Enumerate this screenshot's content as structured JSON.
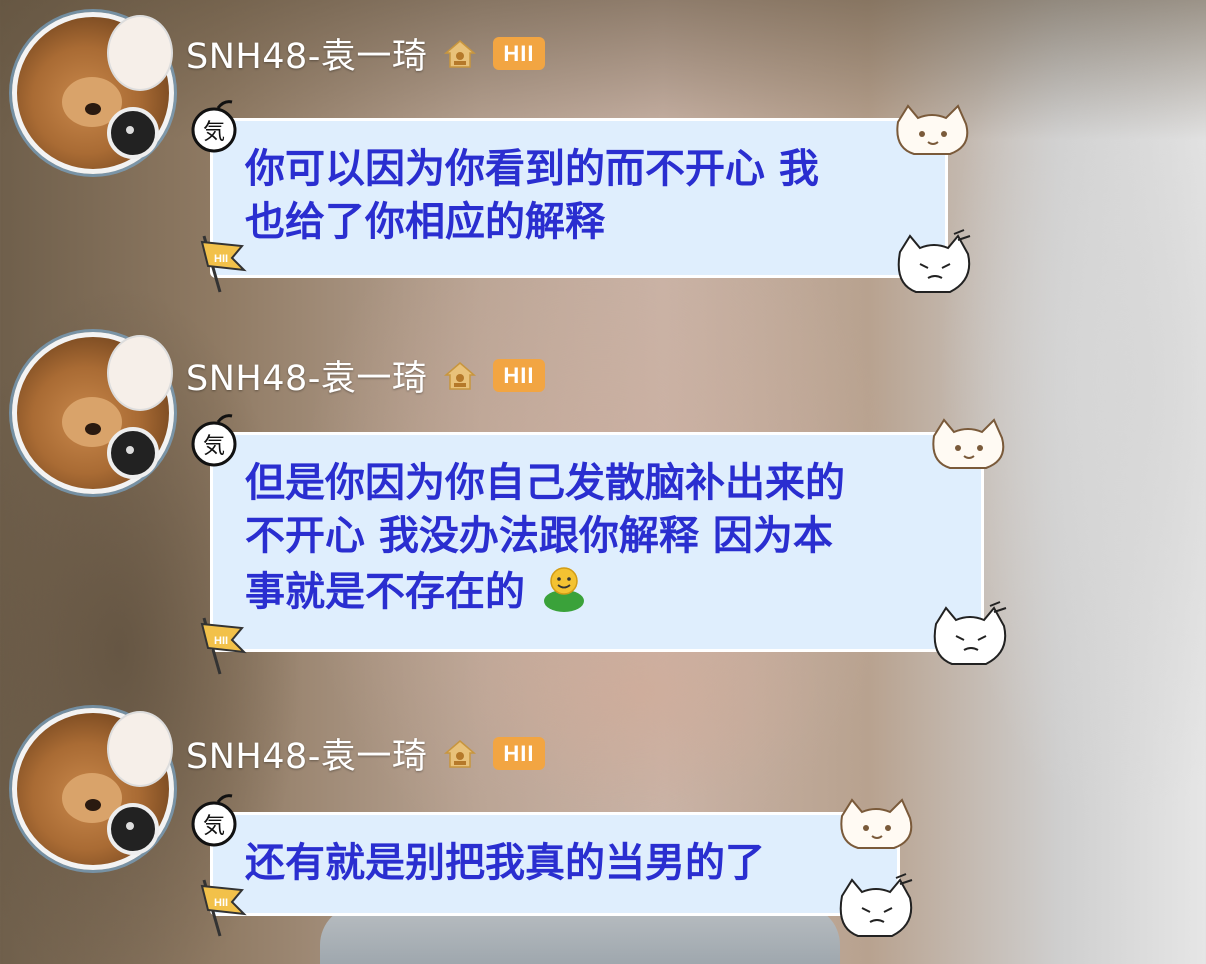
{
  "colors": {
    "bubble_bg": "#dfeefd",
    "bubble_text": "#2a2ed0",
    "badge": "#f2a542",
    "name": "#ffffff"
  },
  "messages": [
    {
      "sender": "SNH48-袁一琦",
      "badge": "HII",
      "lines": [
        "你可以因为你看到的而不开心 我",
        "也给了你相应的解释"
      ],
      "trailing_emoji": null
    },
    {
      "sender": "SNH48-袁一琦",
      "badge": "HII",
      "lines": [
        "但是你因为你自己发散脑补出来的",
        "不开心 我没办法跟你解释 因为本",
        "事就是不存在的"
      ],
      "trailing_emoji": "smiley-emoji"
    },
    {
      "sender": "SNH48-袁一琦",
      "badge": "HII",
      "lines": [
        "还有就是别把我真的当男的了"
      ],
      "trailing_emoji": null
    }
  ],
  "icons": {
    "home": "house-icon",
    "bubble_top_left": "bomb-icon",
    "bubble_bottom_left": "flag-icon",
    "bubble_top_right": "cat-face-icon",
    "bubble_bottom_right": "angry-cat-icon"
  }
}
